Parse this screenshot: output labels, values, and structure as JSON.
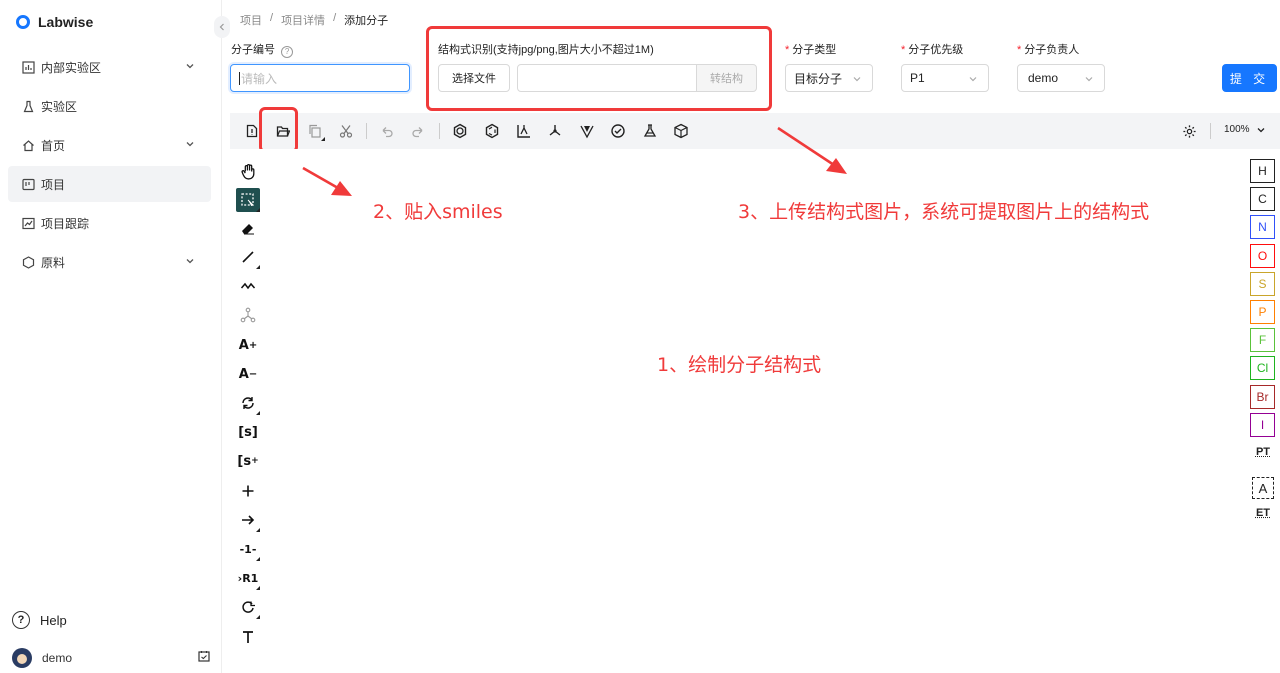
{
  "app": {
    "name": "Labwise"
  },
  "sidebar": {
    "items": [
      {
        "label": "内部实验区",
        "icon": "chart-icon",
        "has_caret": true
      },
      {
        "label": "实验区",
        "icon": "flask-icon",
        "has_caret": false
      },
      {
        "label": "首页",
        "icon": "home-icon",
        "has_caret": true
      },
      {
        "label": "项目",
        "icon": "project-icon",
        "has_caret": false,
        "active": true
      },
      {
        "label": "项目跟踪",
        "icon": "trend-icon",
        "has_caret": false
      },
      {
        "label": "原料",
        "icon": "hexagon-icon",
        "has_caret": true
      }
    ],
    "help_label": "Help",
    "user_name": "demo"
  },
  "breadcrumb": [
    "项目",
    "项目详情",
    "添加分子"
  ],
  "breadcrumb_sep": "/",
  "form": {
    "molecule_code": {
      "label": "分子编号",
      "placeholder": "请输入",
      "value": ""
    },
    "structure_recognition": {
      "label": "结构式识别(支持jpg/png,图片大小不超过1M)",
      "choose_file": "选择文件",
      "file_value": "",
      "convert": "转结构"
    },
    "molecule_type": {
      "label": "分子类型",
      "value": "目标分子"
    },
    "priority": {
      "label": "分子优先级",
      "value": "P1"
    },
    "owner": {
      "label": "分子负责人",
      "value": "demo"
    },
    "submit": "提 交"
  },
  "editor": {
    "zoom": "100%",
    "top_tools": [
      "new-file-icon",
      "open-file-icon",
      "copy-icon",
      "cut-icon",
      "undo-icon",
      "redo-icon",
      "aromatize-icon",
      "dearomatize-icon",
      "layout-icon",
      "clean-icon",
      "stereo-icon",
      "check-icon",
      "analyze-icon",
      "3d-view-icon",
      "settings-icon"
    ],
    "left_tools": [
      "hand-icon",
      "select-icon",
      "eraser-icon",
      "bond-icon",
      "chain-icon",
      "rgroup-icon",
      "charge-plus-icon",
      "charge-minus-icon",
      "rotate-icon",
      "sgroup-icon",
      "data-sgroup-icon",
      "plus-icon",
      "arrow-icon",
      "mapping-icon",
      "rlabel-icon",
      "template-icon",
      "text-icon"
    ],
    "atoms": [
      {
        "symbol": "H",
        "color": "#222222"
      },
      {
        "symbol": "C",
        "color": "#222222"
      },
      {
        "symbol": "N",
        "color": "#3050f8"
      },
      {
        "symbol": "O",
        "color": "#ff0d0d"
      },
      {
        "symbol": "S",
        "color": "#c9a52b"
      },
      {
        "symbol": "P",
        "color": "#ff8000"
      },
      {
        "symbol": "F",
        "color": "#5ac23a"
      },
      {
        "symbol": "Cl",
        "color": "#1fb31f"
      },
      {
        "symbol": "Br",
        "color": "#a62929"
      },
      {
        "symbol": "I",
        "color": "#940094"
      }
    ],
    "right_extras": [
      "PT",
      "A",
      "ET"
    ]
  },
  "annotations": {
    "paste_smiles": "2、贴入smiles",
    "upload_image": "3、上传结构式图片，系统可提取图片上的结构式",
    "draw": "1、绘制分子结构式"
  },
  "colors": {
    "primary": "#1677ff",
    "highlight": "#f03a3a",
    "toolbar_bg": "#f3f4f6"
  }
}
